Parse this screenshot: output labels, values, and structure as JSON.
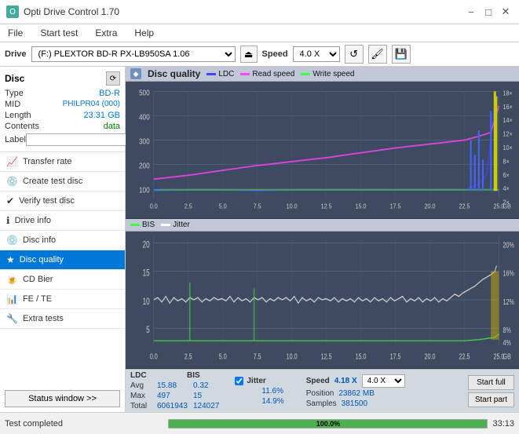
{
  "titleBar": {
    "icon": "O",
    "title": "Opti Drive Control 1.70",
    "minimize": "−",
    "maximize": "□",
    "close": "✕"
  },
  "menuBar": {
    "items": [
      "File",
      "Start test",
      "Extra",
      "Help"
    ]
  },
  "toolbar": {
    "driveLabel": "Drive",
    "driveValue": "(F:) PLEXTOR BD-R  PX-LB950SA 1.06",
    "ejectIcon": "⏏",
    "speedLabel": "Speed",
    "speedValue": "4.0 X",
    "icons": [
      "↺",
      "🖌",
      "💾"
    ]
  },
  "disc": {
    "title": "Disc",
    "iconBtn": "⟳",
    "type": {
      "label": "Type",
      "value": "BD-R"
    },
    "mid": {
      "label": "MID",
      "value": "PHILPR04 (000)"
    },
    "length": {
      "label": "Length",
      "value": "23.31 GB"
    },
    "contents": {
      "label": "Contents",
      "value": "data"
    },
    "label": {
      "label": "Label",
      "placeholder": ""
    }
  },
  "nav": {
    "items": [
      {
        "id": "transfer-rate",
        "label": "Transfer rate",
        "icon": "📈"
      },
      {
        "id": "create-test-disc",
        "label": "Create test disc",
        "icon": "💿"
      },
      {
        "id": "verify-test-disc",
        "label": "Verify test disc",
        "icon": "✔"
      },
      {
        "id": "drive-info",
        "label": "Drive info",
        "icon": "ℹ"
      },
      {
        "id": "disc-info",
        "label": "Disc info",
        "icon": "💿"
      },
      {
        "id": "disc-quality",
        "label": "Disc quality",
        "icon": "★",
        "active": true
      },
      {
        "id": "cd-bier",
        "label": "CD Bier",
        "icon": "🍺"
      },
      {
        "id": "fe-te",
        "label": "FE / TE",
        "icon": "📊"
      },
      {
        "id": "extra-tests",
        "label": "Extra tests",
        "icon": "🔧"
      }
    ],
    "statusBtn": "Status window >>"
  },
  "chart": {
    "title": "Disc quality",
    "legend1": {
      "ldc": {
        "label": "LDC",
        "color": "#4444ff"
      },
      "readSpeed": {
        "label": "Read speed",
        "color": "#ff44ff"
      },
      "writeSpeed": {
        "label": "Write speed",
        "color": "#44ff44"
      }
    },
    "legend2": {
      "bis": {
        "label": "BIS",
        "color": "#44ff44"
      },
      "jitter": {
        "label": "Jitter",
        "color": "#ffffff"
      }
    },
    "xAxis": [
      "0.0",
      "2.5",
      "5.0",
      "7.5",
      "10.0",
      "12.5",
      "15.0",
      "17.5",
      "20.0",
      "22.5",
      "25.0"
    ],
    "yAxis1": [
      "500",
      "400",
      "300",
      "200",
      "100"
    ],
    "yAxis1Right": [
      "18×",
      "16×",
      "14×",
      "12×",
      "10×",
      "8×",
      "6×",
      "4×",
      "2×"
    ],
    "yAxis2": [
      "20",
      "15",
      "10",
      "5"
    ],
    "yAxis2Right": [
      "20%",
      "16%",
      "12%",
      "8%",
      "4%"
    ]
  },
  "stats": {
    "headers": [
      "LDC",
      "BIS",
      "",
      "Jitter",
      "Speed",
      "",
      ""
    ],
    "avg": {
      "ldc": "15.88",
      "bis": "0.32",
      "jitter": "11.6%"
    },
    "max": {
      "ldc": "497",
      "bis": "15",
      "jitter": "14.9%"
    },
    "total": {
      "ldc": "6061943",
      "bis": "124027"
    },
    "speed": {
      "value": "4.18 X",
      "select": "4.0 X"
    },
    "position": {
      "label": "Position",
      "value": "23862 MB"
    },
    "samples": {
      "label": "Samples",
      "value": "381500"
    },
    "buttons": {
      "startFull": "Start full",
      "startPart": "Start part"
    }
  },
  "statusBar": {
    "text": "Test completed",
    "progress": 100,
    "progressLabel": "100.0%",
    "time": "33:13"
  }
}
